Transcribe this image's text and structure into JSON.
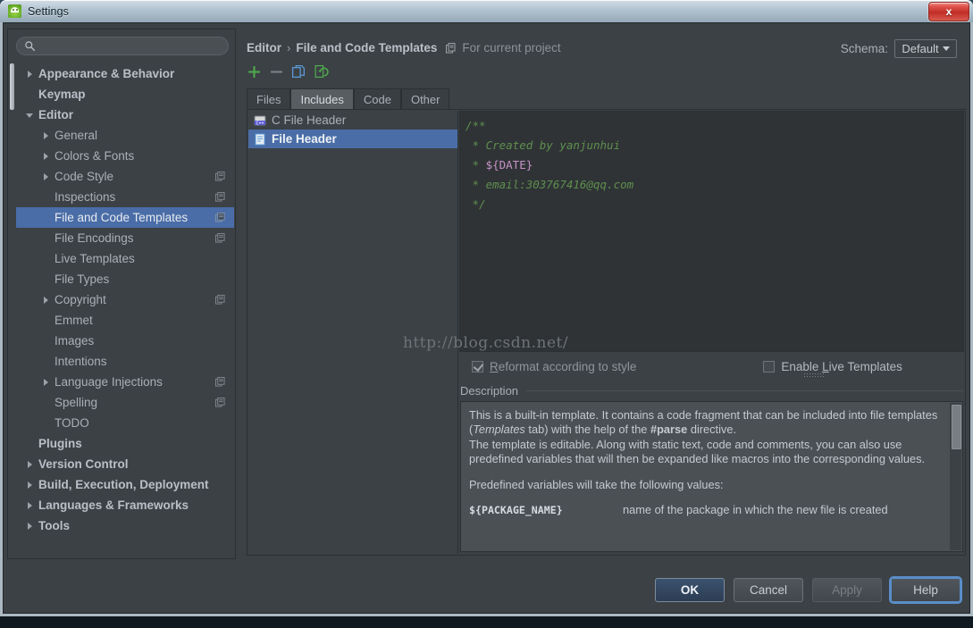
{
  "window": {
    "title": "Settings",
    "app_icon": "android-studio-icon",
    "close_label": "x"
  },
  "sidebar": {
    "search": {
      "value": "",
      "placeholder": ""
    },
    "items": [
      {
        "label": "Appearance & Behavior",
        "indent": 0,
        "arrow": "right",
        "bold": true,
        "badge": false,
        "selected": false
      },
      {
        "label": "Keymap",
        "indent": 0,
        "arrow": "none",
        "bold": true,
        "badge": false,
        "selected": false
      },
      {
        "label": "Editor",
        "indent": 0,
        "arrow": "down",
        "bold": true,
        "badge": false,
        "selected": false
      },
      {
        "label": "General",
        "indent": 1,
        "arrow": "right",
        "bold": false,
        "badge": false,
        "selected": false
      },
      {
        "label": "Colors & Fonts",
        "indent": 1,
        "arrow": "right",
        "bold": false,
        "badge": false,
        "selected": false
      },
      {
        "label": "Code Style",
        "indent": 1,
        "arrow": "right",
        "bold": false,
        "badge": true,
        "selected": false
      },
      {
        "label": "Inspections",
        "indent": 1,
        "arrow": "none",
        "bold": false,
        "badge": true,
        "selected": false
      },
      {
        "label": "File and Code Templates",
        "indent": 1,
        "arrow": "none",
        "bold": false,
        "badge": true,
        "selected": true
      },
      {
        "label": "File Encodings",
        "indent": 1,
        "arrow": "none",
        "bold": false,
        "badge": true,
        "selected": false
      },
      {
        "label": "Live Templates",
        "indent": 1,
        "arrow": "none",
        "bold": false,
        "badge": false,
        "selected": false
      },
      {
        "label": "File Types",
        "indent": 1,
        "arrow": "none",
        "bold": false,
        "badge": false,
        "selected": false
      },
      {
        "label": "Copyright",
        "indent": 1,
        "arrow": "right",
        "bold": false,
        "badge": true,
        "selected": false
      },
      {
        "label": "Emmet",
        "indent": 1,
        "arrow": "none",
        "bold": false,
        "badge": false,
        "selected": false
      },
      {
        "label": "Images",
        "indent": 1,
        "arrow": "none",
        "bold": false,
        "badge": false,
        "selected": false
      },
      {
        "label": "Intentions",
        "indent": 1,
        "arrow": "none",
        "bold": false,
        "badge": false,
        "selected": false
      },
      {
        "label": "Language Injections",
        "indent": 1,
        "arrow": "right",
        "bold": false,
        "badge": true,
        "selected": false
      },
      {
        "label": "Spelling",
        "indent": 1,
        "arrow": "none",
        "bold": false,
        "badge": true,
        "selected": false
      },
      {
        "label": "TODO",
        "indent": 1,
        "arrow": "none",
        "bold": false,
        "badge": false,
        "selected": false
      },
      {
        "label": "Plugins",
        "indent": 0,
        "arrow": "none",
        "bold": true,
        "badge": false,
        "selected": false
      },
      {
        "label": "Version Control",
        "indent": 0,
        "arrow": "right",
        "bold": true,
        "badge": false,
        "selected": false
      },
      {
        "label": "Build, Execution, Deployment",
        "indent": 0,
        "arrow": "right",
        "bold": true,
        "badge": false,
        "selected": false
      },
      {
        "label": "Languages & Frameworks",
        "indent": 0,
        "arrow": "right",
        "bold": true,
        "badge": false,
        "selected": false
      },
      {
        "label": "Tools",
        "indent": 0,
        "arrow": "right",
        "bold": true,
        "badge": false,
        "selected": false
      }
    ]
  },
  "main": {
    "breadcrumb": {
      "root": "Editor",
      "separator": "›",
      "current": "File and Code Templates",
      "scope_note": "For current project"
    },
    "schema": {
      "label": "Schema:",
      "value": "Default"
    },
    "toolbar": {
      "add": "add-icon",
      "remove": "remove-icon",
      "copy": "copy-icon",
      "reset": "reset-icon"
    },
    "tabs": [
      {
        "label": "Files",
        "active": false
      },
      {
        "label": "Includes",
        "active": true
      },
      {
        "label": "Code",
        "active": false
      },
      {
        "label": "Other",
        "active": false
      }
    ],
    "templates": [
      {
        "label": "C File Header",
        "icon": "c-file-icon",
        "selected": false
      },
      {
        "label": "File Header",
        "icon": "text-file-icon",
        "selected": true
      }
    ],
    "editor": {
      "lines": [
        {
          "text": "/**",
          "kind": "comment"
        },
        {
          "text": " * Created by yanjunhui",
          "kind": "comment"
        },
        {
          "text": " * ${DATE}",
          "kind": "comment-var"
        },
        {
          "text": " * email:303767416@qq.com",
          "kind": "comment"
        },
        {
          "text": " */",
          "kind": "comment"
        }
      ],
      "line1": "/**",
      "line2": " * Created by yanjunhui",
      "line3_prefix": " * ",
      "line3_var": "${DATE}",
      "line4": " * email:303767416@qq.com",
      "line5": " */"
    },
    "options": {
      "reformat": {
        "label_pre": "R",
        "label_post": "eformat according to style",
        "checked": true,
        "enabled": false
      },
      "live_templates": {
        "label_pre": "Enable ",
        "label_u": "L",
        "label_post": "ive Templates",
        "checked": false,
        "enabled": true
      }
    },
    "description": {
      "title": "Description",
      "p1_a": "This is a built-in template. It contains a code fragment that can be included into file templates (",
      "p1_it": "Templates",
      "p1_b": " tab) with the help of the ",
      "p1_bd": "#parse",
      "p1_c": " directive.",
      "p2": "The template is editable. Along with static text, code and comments, you can also use predefined variables that will then be expanded like macros into the corresponding values.",
      "p3": "Predefined variables will take the following values:",
      "var_name": "${PACKAGE_NAME}",
      "var_desc": "name of the package in which the new file is created"
    }
  },
  "watermark": "http://blog.csdn.net/",
  "buttons": [
    {
      "label": "OK",
      "style": "primary",
      "disabled": false,
      "focused": false
    },
    {
      "label": "Cancel",
      "style": "normal",
      "disabled": false,
      "focused": false
    },
    {
      "label": "Apply",
      "style": "disabled",
      "disabled": true,
      "focused": false
    },
    {
      "label": "Help",
      "style": "normal",
      "disabled": false,
      "focused": true
    }
  ],
  "colors": {
    "selection_blue": "#4a6da7",
    "accent_green": "#4fa84f",
    "accent_blue": "#5a8ec9",
    "comment_green": "#5f8f4e",
    "variable_pink": "#c792c7",
    "window_bg": "#3c4145",
    "close_red": "#c22d26"
  }
}
